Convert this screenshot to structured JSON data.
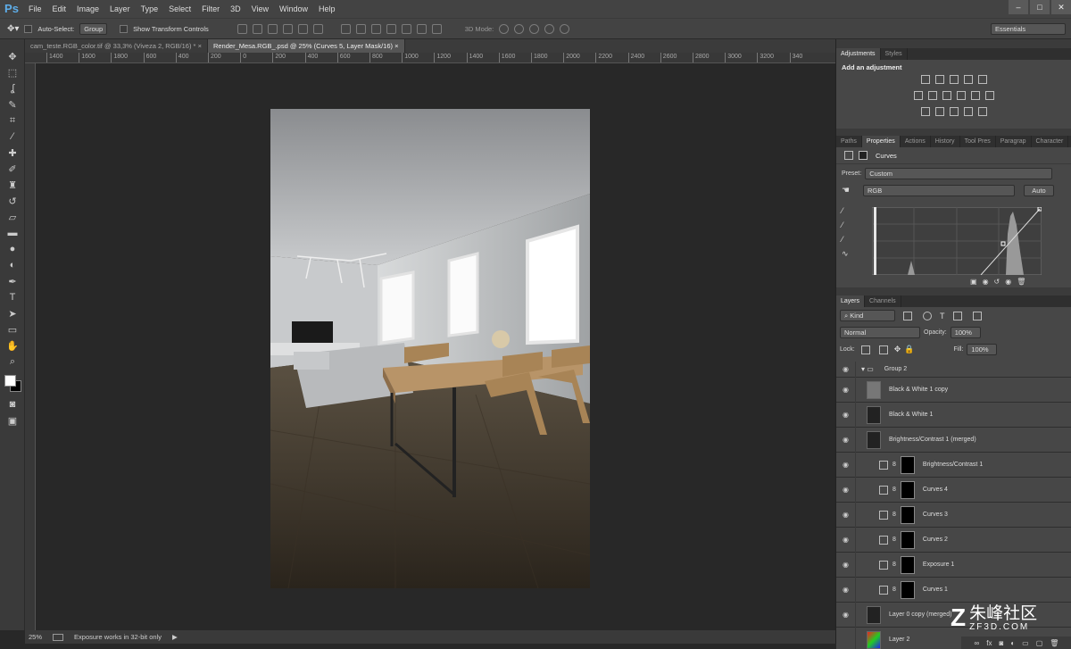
{
  "app": {
    "logo": "Ps"
  },
  "menu": [
    "File",
    "Edit",
    "Image",
    "Layer",
    "Type",
    "Select",
    "Filter",
    "3D",
    "View",
    "Window",
    "Help"
  ],
  "options": {
    "auto_select": "Auto-Select:",
    "auto_select_value": "Group",
    "show_transform": "Show Transform Controls",
    "mode_3d": "3D Mode:",
    "workspace": "Essentials"
  },
  "tabs": [
    {
      "label": "cam_teste.RGB_color.tif @ 33,3% (Viveza 2, RGB/16) *"
    },
    {
      "label": "Render_Mesa.RGB_.psd @ 25% (Curves 5, Layer Mask/16)"
    }
  ],
  "ruler": [
    "1400",
    "1600",
    "1800",
    "600",
    "400",
    "200",
    "0",
    "200",
    "400",
    "600",
    "800",
    "1000",
    "1200",
    "1400",
    "1600",
    "1800",
    "2000",
    "2200",
    "2400",
    "2600",
    "2800",
    "3000",
    "3200",
    "340"
  ],
  "status": {
    "zoom": "25%",
    "message": "Exposure works in 32-bit only"
  },
  "adjustments": {
    "tabs": [
      "Adjustments",
      "Styles"
    ],
    "title": "Add an adjustment"
  },
  "properties": {
    "tabs": [
      "Paths",
      "Properties",
      "Actions",
      "History",
      "Tool Pres",
      "Paragrap",
      "Character"
    ],
    "title": "Curves",
    "preset_label": "Preset:",
    "preset_value": "Custom",
    "channel": "RGB",
    "auto": "Auto"
  },
  "layers_panel": {
    "tabs": [
      "Layers",
      "Channels"
    ],
    "kind": "Kind",
    "blend": "Normal",
    "opacity_label": "Opacity:",
    "opacity": "100%",
    "lock_label": "Lock:",
    "fill_label": "Fill:",
    "fill": "100%",
    "layers": [
      {
        "name": "Group 2",
        "type": "group"
      },
      {
        "name": "Black & White 1 copy",
        "type": "pixel"
      },
      {
        "name": "Black & White 1",
        "type": "pixel"
      },
      {
        "name": "Brightness/Contrast 1 (merged)",
        "type": "pixel"
      },
      {
        "name": "Brightness/Contrast 1",
        "type": "adj"
      },
      {
        "name": "Curves 4",
        "type": "adj"
      },
      {
        "name": "Curves 3",
        "type": "adj"
      },
      {
        "name": "Curves 2",
        "type": "adj"
      },
      {
        "name": "Exposure 1",
        "type": "adj"
      },
      {
        "name": "Curves 1",
        "type": "adj"
      },
      {
        "name": "Layer 0 copy (merged)",
        "type": "pixel"
      },
      {
        "name": "Layer 2",
        "type": "color"
      }
    ]
  },
  "watermark": {
    "text": "朱峰社区",
    "sub": "ZF3D.COM"
  }
}
